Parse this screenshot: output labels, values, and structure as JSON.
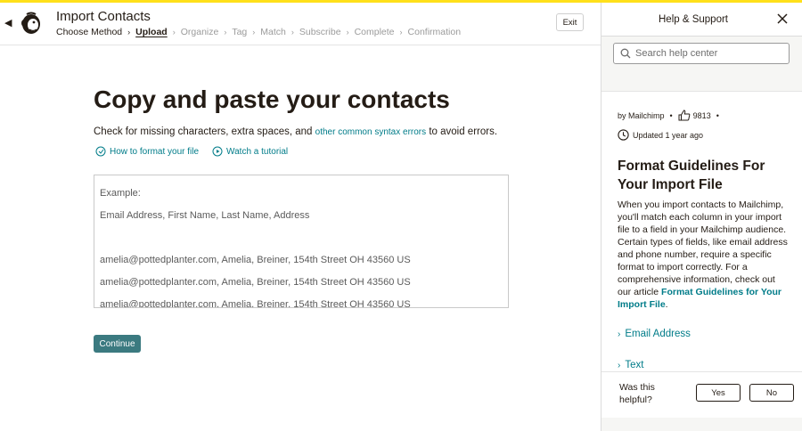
{
  "app": {
    "title": "Import Contacts",
    "exit_label": "Exit",
    "steps": [
      {
        "label": "Choose Method"
      },
      {
        "label": "Upload"
      },
      {
        "label": "Organize"
      },
      {
        "label": "Tag"
      },
      {
        "label": "Match"
      },
      {
        "label": "Subscribe"
      },
      {
        "label": "Complete"
      },
      {
        "label": "Confirmation"
      }
    ]
  },
  "main": {
    "heading": "Copy and paste your contacts",
    "desc_before": "Check for missing characters, extra spaces, and ",
    "desc_link": "other common syntax errors",
    "desc_after": " to avoid errors.",
    "link_format": "How to format your file",
    "link_tutorial": "Watch a tutorial",
    "example_lines": {
      "label": "Example:",
      "header": "Email Address, First Name, Last Name, Address",
      "row1": "amelia@pottedplanter.com, Amelia, Breiner, 154th Street OH 43560 US",
      "row2": "amelia@pottedplanter.com, Amelia, Breiner, 154th Street OH 43560 US",
      "row3": "amelia@pottedplanter.com, Amelia, Breiner, 154th Street OH 43560 US"
    },
    "continue_label": "Continue"
  },
  "help": {
    "title": "Help & Support",
    "search_placeholder": "Search help center",
    "author": "by Mailchimp",
    "likes": "9813",
    "updated": "Updated 1 year ago",
    "article_title": "Format Guidelines For Your Import File",
    "article_body": "When you import contacts to Mailchimp, you'll match each column in your import file to a field in your Mailchimp audience. Certain types of fields, like email address and phone number, require a specific format to import correctly. For a comprehensive information, check out our article ",
    "article_link": "Format Guidelines for Your Import File",
    "article_end": ".",
    "accordion_1": "Email Address",
    "accordion_2": "Text",
    "feedback_q": "Was this helpful?",
    "yes_label": "Yes",
    "no_label": "No"
  },
  "colors": {
    "accent_yellow": "#ffe01b",
    "link_teal": "#007c89",
    "button_teal": "#3b7a80"
  }
}
